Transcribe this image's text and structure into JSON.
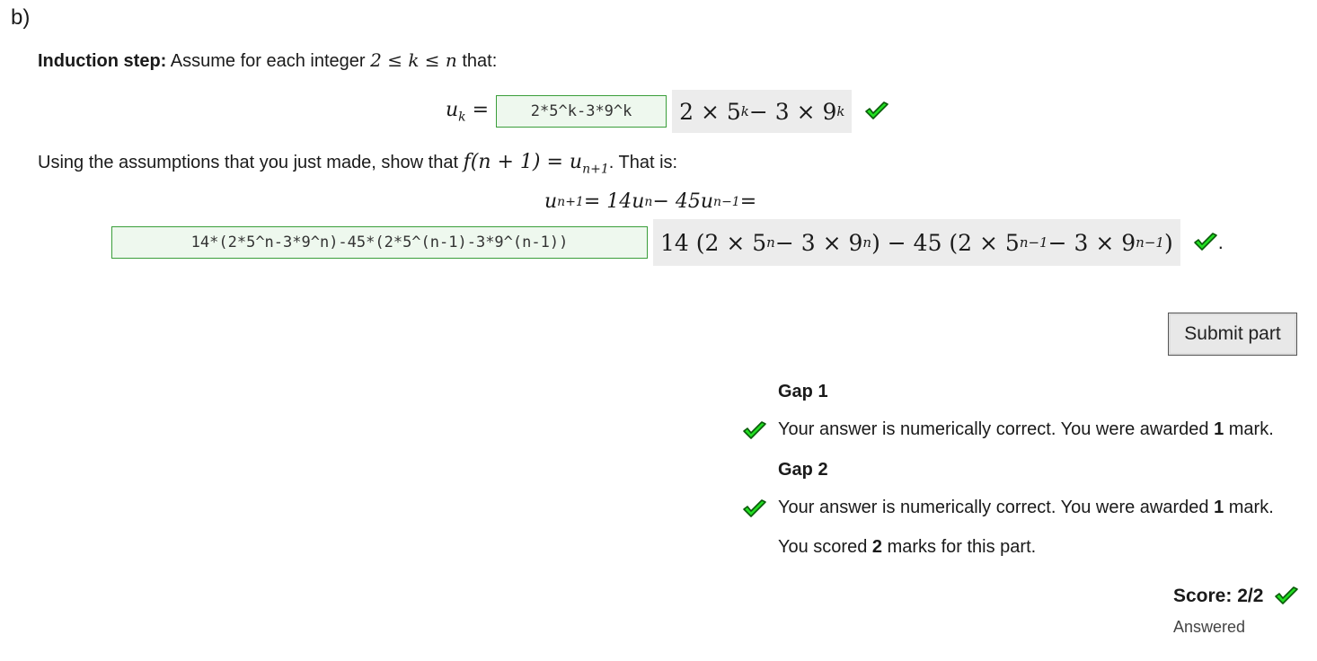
{
  "part": {
    "label": "b)"
  },
  "induction": {
    "bold": "Induction step:",
    "text_before": " Assume for each integer ",
    "math": "2 ≤ k ≤ n",
    "text_after": " that:"
  },
  "gap1": {
    "lhs": "u",
    "lhs_sub": "k",
    "equals": " =",
    "input_value": "2*5^k-3*9^k",
    "preview": "2 × 5",
    "preview_sup1": "k",
    "preview_mid": " − 3 × 9",
    "preview_sup2": "k"
  },
  "show": {
    "text_before": "Using the assumptions that you just made, show that ",
    "math_f": "f(n + 1) = u",
    "math_sub": "n+1",
    "text_after": ". That is:"
  },
  "recurrence": {
    "a": "u",
    "a_sub": "n+1",
    "b": " = 14u",
    "b_sub": "n",
    "c": " − 45u",
    "c_sub": "n−1",
    "d": " ="
  },
  "gap2": {
    "input_value": "14*(2*5^n-3*9^n)-45*(2*5^(n-1)-3*9^(n-1))",
    "preview_a": "14 (2 × 5",
    "preview_sup1": "n",
    "preview_b": " − 3 × 9",
    "preview_sup2": "n",
    "preview_c": ") − 45 (2 × 5",
    "preview_sup3": "n−1",
    "preview_d": " − 3 × 9",
    "preview_sup4": "n−1",
    "preview_e": ")",
    "trailing": "."
  },
  "submit": {
    "label": "Submit part"
  },
  "feedback": {
    "gap1_title": "Gap 1",
    "gap1_text": "Your answer is numerically correct. You were awarded ",
    "gap1_marks": "1",
    "gap1_suffix": " mark.",
    "gap2_title": "Gap 2",
    "gap2_text": "Your answer is numerically correct. You were awarded ",
    "gap2_marks": "1",
    "gap2_suffix": " mark.",
    "summary_before": "You scored ",
    "summary_marks": "2",
    "summary_after": " marks for this part."
  },
  "score": {
    "label": "Score: 2/2",
    "status": "Answered"
  },
  "colors": {
    "tick_fill": "#22dd22",
    "tick_stroke": "#0a5a0a",
    "input_border": "#3a9e3a"
  },
  "icons": {
    "correct": "check-mark-icon"
  }
}
